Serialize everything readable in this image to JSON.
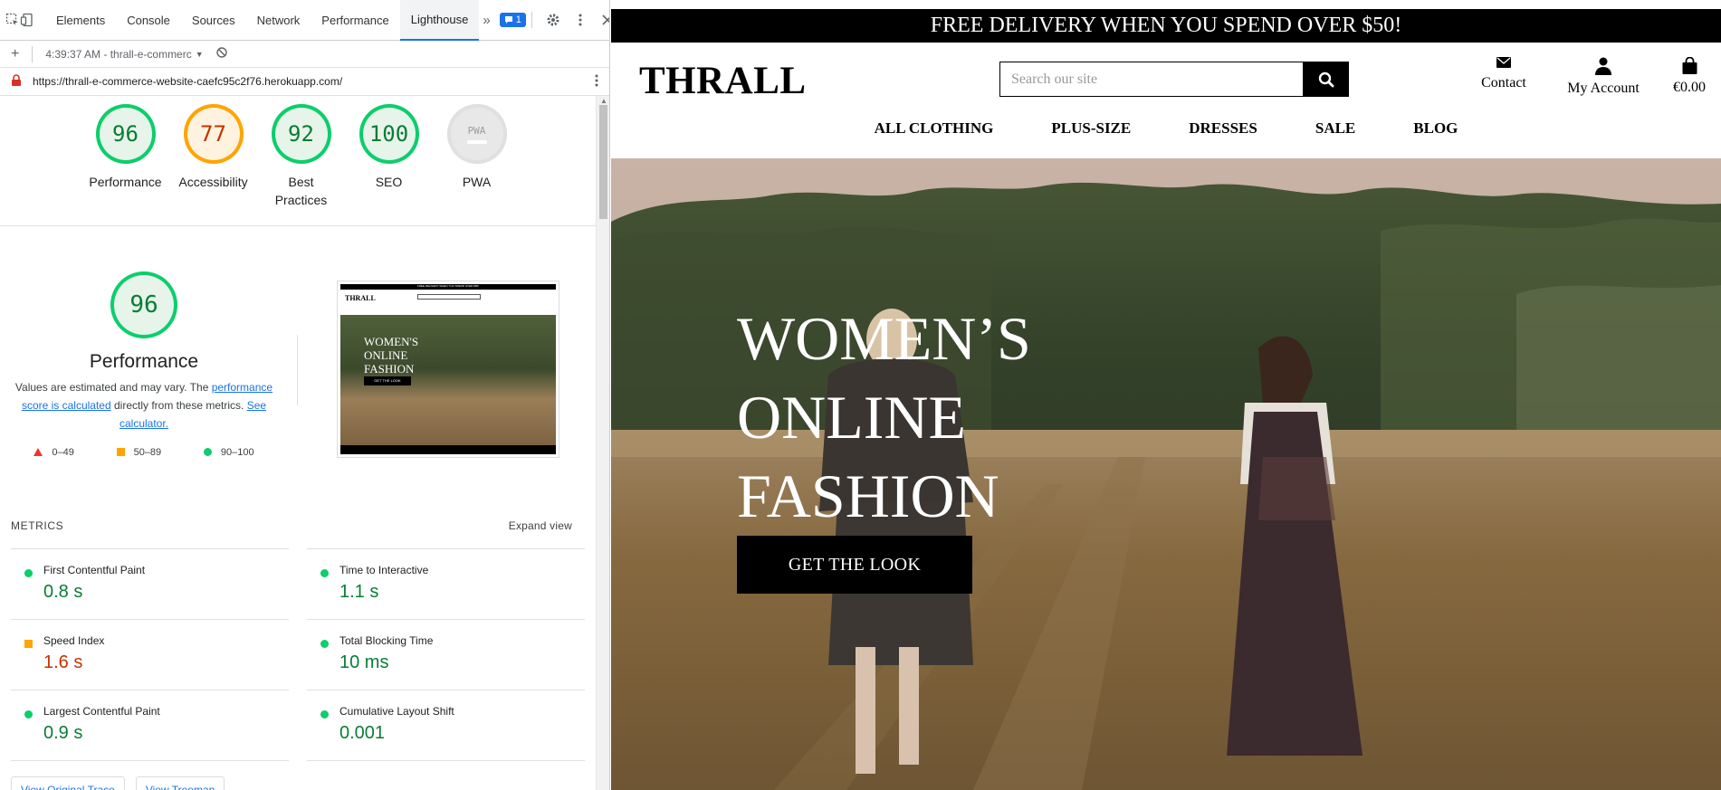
{
  "devtools": {
    "tabs": [
      "Elements",
      "Console",
      "Sources",
      "Network",
      "Performance",
      "Lighthouse"
    ],
    "active_tab": "Lighthouse",
    "issues_count": "1",
    "report_time": "4:39:37 AM - thrall-e-commerc",
    "url": "https://thrall-e-commerce-website-caefc95c2f76.herokuapp.com/",
    "gauges": [
      {
        "score": "96",
        "label": "Performance",
        "color": "green"
      },
      {
        "score": "77",
        "label": "Accessibility",
        "color": "orange"
      },
      {
        "score": "92",
        "label": "Best Practices",
        "color": "green"
      },
      {
        "score": "100",
        "label": "SEO",
        "color": "green"
      },
      {
        "score": "PWA",
        "label": "PWA",
        "color": "grey"
      }
    ],
    "performance": {
      "score": "96",
      "title": "Performance",
      "desc_1": "Values are estimated and may vary. The ",
      "link_1": "performance score is calculated",
      "desc_2": " directly from these metrics. ",
      "link_2": "See calculator.",
      "legend": [
        "0–49",
        "50–89",
        "90–100"
      ]
    },
    "metrics_title": "METRICS",
    "expand_view": "Expand view",
    "metrics": [
      {
        "label": "First Contentful Paint",
        "value": "0.8 s",
        "status": "green"
      },
      {
        "label": "Time to Interactive",
        "value": "1.1 s",
        "status": "green"
      },
      {
        "label": "Speed Index",
        "value": "1.6 s",
        "status": "orange"
      },
      {
        "label": "Total Blocking Time",
        "value": "10 ms",
        "status": "green"
      },
      {
        "label": "Largest Contentful Paint",
        "value": "0.9 s",
        "status": "green"
      },
      {
        "label": "Cumulative Layout Shift",
        "value": "0.001",
        "status": "green"
      }
    ],
    "bottom_buttons": [
      "View Original Trace",
      "View Treemap"
    ],
    "thumbnail": {
      "banner": "FREE DELIVERY WHEN YOU SPEND OVER $50!",
      "logo": "THRALL",
      "title": "WOMEN'S ONLINE FASHION",
      "button": "GET THE LOOK"
    }
  },
  "site": {
    "promo": "FREE DELIVERY WHEN YOU SPEND OVER $50!",
    "logo": "THRALL",
    "search_placeholder": "Search our site",
    "header_links": [
      {
        "label": "Contact",
        "icon": "envelope-icon"
      },
      {
        "label": "My Account",
        "icon": "user-icon"
      },
      {
        "label": "€0.00",
        "icon": "shopping-bag-icon"
      }
    ],
    "nav": [
      "ALL CLOTHING",
      "PLUS-SIZE",
      "DRESSES",
      "SALE",
      "BLOG"
    ],
    "hero_lines": [
      "WOMEN’S",
      "ONLINE",
      "FASHION"
    ],
    "hero_button": "GET THE LOOK"
  }
}
